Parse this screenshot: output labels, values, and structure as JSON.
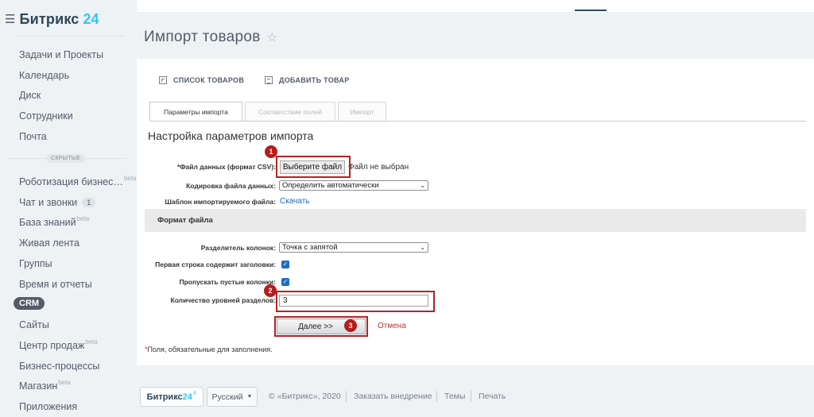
{
  "sidebar": {
    "logo_text": "Битрикс",
    "logo_number": "24",
    "items": [
      {
        "label": "Задачи и Проекты"
      },
      {
        "label": "Календарь"
      },
      {
        "label": "Диск"
      },
      {
        "label": "Сотрудники"
      },
      {
        "label": "Почта"
      }
    ],
    "hidden_label": "СКРЫТЫЕ",
    "hidden_items": [
      {
        "label": "Роботизация бизнес…",
        "badge": "beta"
      },
      {
        "label": "Чат и звонки",
        "count": "1"
      },
      {
        "label": "База знаний",
        "badge": "beta"
      },
      {
        "label": "Живая лента"
      },
      {
        "label": "Группы"
      },
      {
        "label": "Время и отчеты"
      },
      {
        "label": "CRM"
      },
      {
        "label": "Сайты"
      },
      {
        "label": "Центр продаж",
        "badge": "beta"
      },
      {
        "label": "Бизнес-процессы"
      },
      {
        "label": "Магазин",
        "badge": "beta"
      },
      {
        "label": "Приложения"
      }
    ]
  },
  "page": {
    "title": "Импорт товаров"
  },
  "toolbar": {
    "products_list": "СПИСОК ТОВАРОВ",
    "add_product": "ДОБАВИТЬ ТОВАР"
  },
  "tabs": [
    {
      "label": "Параметры импорта",
      "active": true
    },
    {
      "label": "Соответствие полей",
      "active": false
    },
    {
      "label": "Импорт",
      "active": false
    }
  ],
  "form": {
    "section_title": "Настройка параметров импорта",
    "file_label": "*Файл данных (формат CSV):",
    "file_button": "Выберите файл",
    "file_status": "Файл не выбран",
    "encoding_label": "Кодировка файла данных:",
    "encoding_value": "Определить автоматически",
    "template_label": "Шаблон импортируемого файла:",
    "template_link": "Скачать",
    "format_title": "Формат файла",
    "delimiter_label": "Разделитель колонок:",
    "delimiter_value": "Точка с запятой",
    "first_row_label": "Первая строка содержит заголовки:",
    "skip_empty_label": "Пропускать пустые колонки:",
    "levels_label": "Количество уровней разделов:",
    "levels_value": "3",
    "next_button": "Далее >>",
    "cancel_link": "Отмена",
    "required_star": "*",
    "required_note": "Поля, обязательные для заполнения."
  },
  "annotations": [
    "1",
    "2",
    "3"
  ],
  "footer": {
    "logo_text": "Битрикс",
    "logo_number": "24",
    "logo_reg": "®",
    "language": "Русский",
    "copyright": "© «Битрикс», 2020",
    "order_link": "Заказать внедрение",
    "themes_link": "Темы",
    "print_link": "Печать"
  },
  "colors": {
    "accent": "#2fc6f6",
    "link": "#2067b0",
    "highlight": "#b12424",
    "checkbox": "#1f6bc4"
  }
}
